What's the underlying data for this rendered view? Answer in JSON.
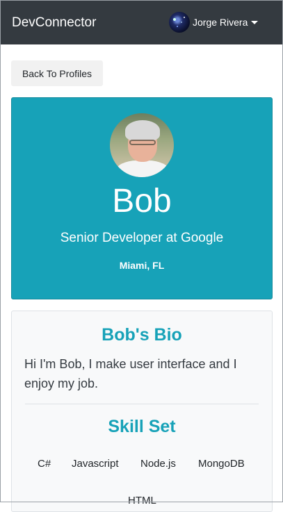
{
  "navbar": {
    "brand": "DevConnector",
    "user_name": "Jorge Rivera"
  },
  "actions": {
    "back_label": "Back To Profiles"
  },
  "profile": {
    "name": "Bob",
    "title": "Senior Developer at Google",
    "location": "Miami, FL"
  },
  "bio": {
    "heading": "Bob's Bio",
    "text": "Hi I'm Bob, I make user interface and I enjoy my job."
  },
  "skills": {
    "heading": "Skill Set",
    "items": [
      "C#",
      "Javascript",
      "Node.js",
      "MongoDB",
      "HTML"
    ]
  },
  "colors": {
    "navbar": "#343a40",
    "accent": "#17a2b8",
    "card_bg": "#f8f9fa"
  }
}
